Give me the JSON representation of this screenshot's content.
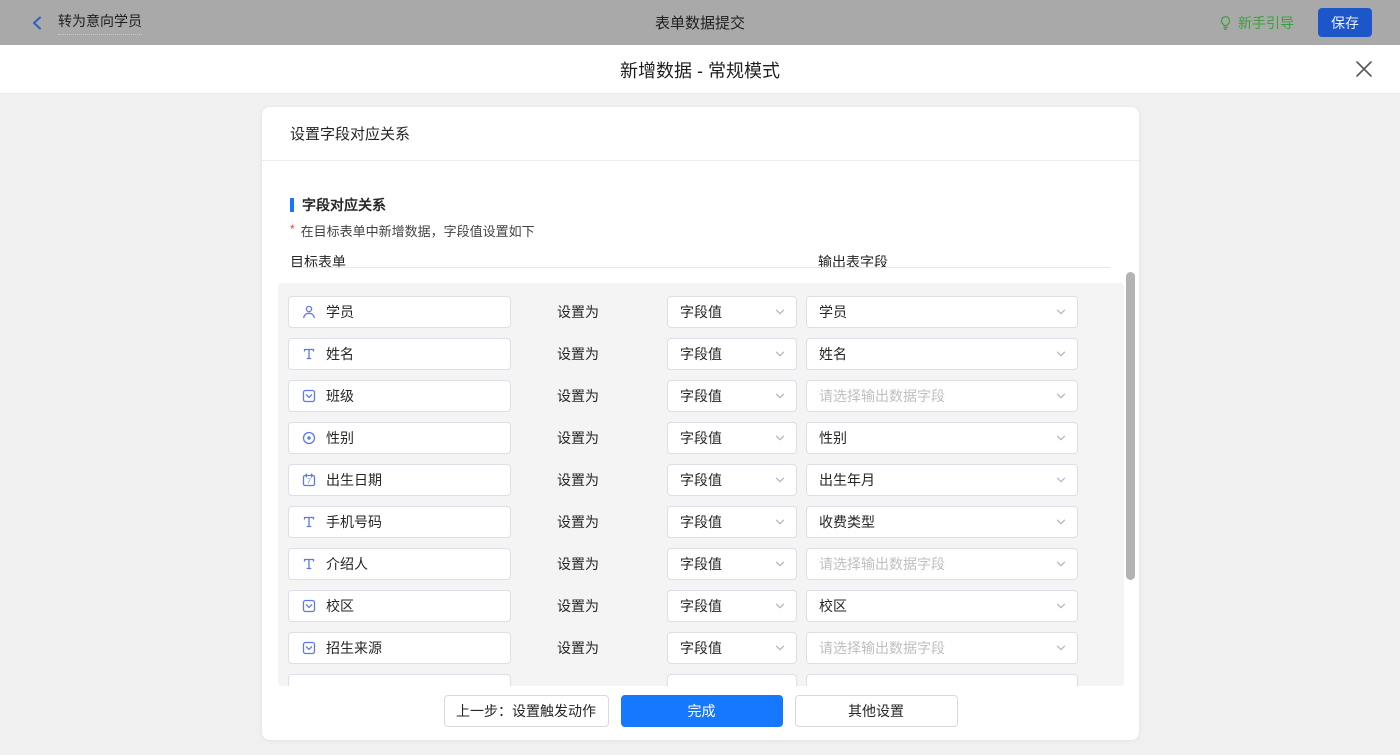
{
  "topbar": {
    "back_label": "转为意向学员",
    "title": "表单数据提交",
    "guide_label": "新手引导",
    "save_label": "保存"
  },
  "modal": {
    "title": "新增数据 - 常规模式"
  },
  "card": {
    "header": "设置字段对应关系",
    "section_title": "字段对应关系",
    "required_mark": "*",
    "note": "在目标表单中新增数据，字段值设置如下",
    "col_left": "目标表单",
    "col_right": "输出表字段",
    "set_as_label": "设置为",
    "field_value_label": "字段值",
    "output_placeholder": "请选择输出数据字段"
  },
  "rows": [
    {
      "icon": "user-icon",
      "field": "学员",
      "value": "学员",
      "is_placeholder": false
    },
    {
      "icon": "text-icon",
      "field": "姓名",
      "value": "姓名",
      "is_placeholder": false
    },
    {
      "icon": "select-icon",
      "field": "班级",
      "value": "请选择输出数据字段",
      "is_placeholder": true
    },
    {
      "icon": "radio-icon",
      "field": "性别",
      "value": "性别",
      "is_placeholder": false
    },
    {
      "icon": "calendar-icon",
      "field": "出生日期",
      "value": "出生年月",
      "is_placeholder": false
    },
    {
      "icon": "text-icon",
      "field": "手机号码",
      "value": "收费类型",
      "is_placeholder": false
    },
    {
      "icon": "text-icon",
      "field": "介绍人",
      "value": "请选择输出数据字段",
      "is_placeholder": true
    },
    {
      "icon": "select-icon",
      "field": "校区",
      "value": "校区",
      "is_placeholder": false
    },
    {
      "icon": "select-icon",
      "field": "招生来源",
      "value": "请选择输出数据字段",
      "is_placeholder": true
    }
  ],
  "footer": {
    "prev_label": "上一步：设置触发动作",
    "done_label": "完成",
    "other_label": "其他设置"
  },
  "colors": {
    "primary_blue": "#1677ff",
    "save_button_blue": "#1d56c9",
    "guide_green": "#3ba13e",
    "field_icon_blue": "#5b78f0",
    "required_red": "#e5484d",
    "topbar_gray": "#a9a9a9"
  }
}
